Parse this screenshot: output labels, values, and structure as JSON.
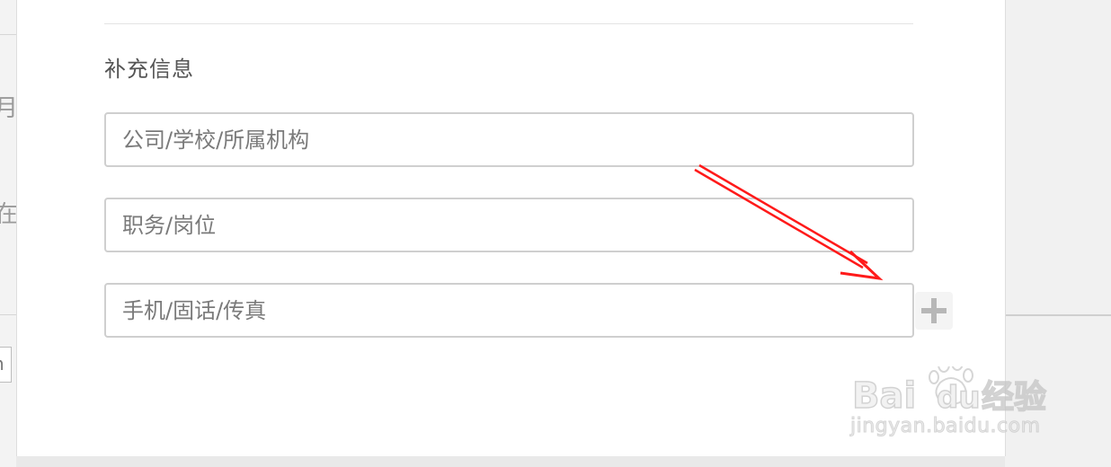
{
  "section": {
    "title": "补充信息"
  },
  "fields": [
    {
      "placeholder": "公司/学校/所属机构",
      "value": ""
    },
    {
      "placeholder": "职务/岗位",
      "value": ""
    },
    {
      "placeholder": "手机/固话/传真",
      "value": ""
    }
  ],
  "add_button": {
    "icon": "plus-icon"
  },
  "background": {
    "left_fragments": [
      "月",
      "在",
      "n"
    ]
  },
  "watermark": {
    "logo_text": "Bai du 经验",
    "url": "jingyan.baidu.com"
  },
  "annotation": {
    "color": "#ff0000",
    "icon": "arrow-icon"
  }
}
